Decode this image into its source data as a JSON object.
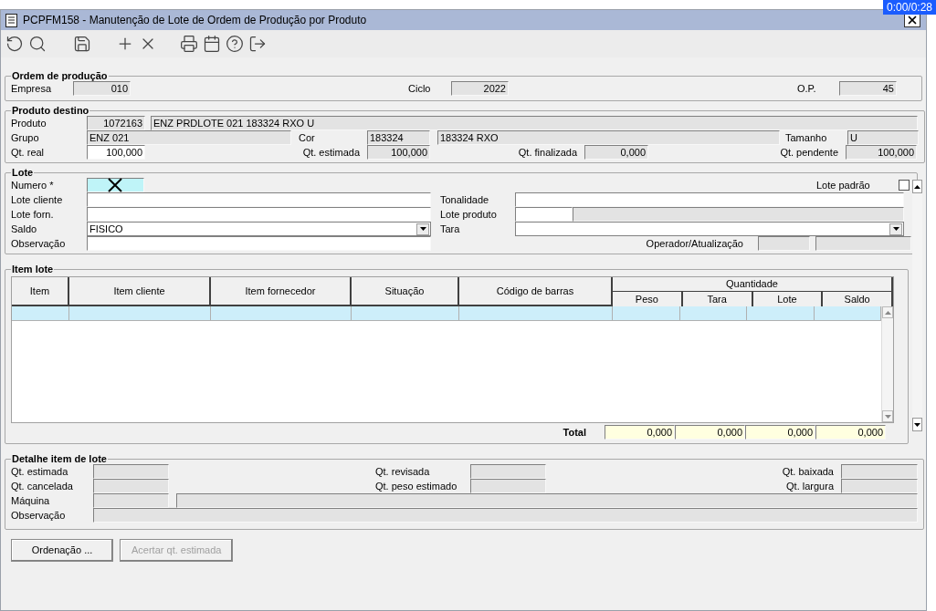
{
  "window": {
    "title": "PCPFM158 - Manutenção de Lote de Ordem de Produção por Produto"
  },
  "player_time": "0:00/0:28",
  "ordem": {
    "title": "Ordem de produção",
    "fields": [
      {
        "label": "Empresa",
        "value": "010"
      },
      {
        "label": "Ciclo",
        "value": "2022"
      },
      {
        "label": "O.P.",
        "value": "45"
      }
    ]
  },
  "produto": {
    "title": "Produto destino",
    "produto": {
      "label": "Produto",
      "code": "1072163",
      "name": "ENZ PRDLOTE 021 183324 RXO U"
    },
    "grupo": {
      "label": "Grupo",
      "value": "ENZ 021"
    },
    "cor": {
      "label": "Cor",
      "code": "183324",
      "name": "183324 RXO"
    },
    "tamanho": {
      "label": "Tamanho",
      "value": "U"
    },
    "qt_real": {
      "label": "Qt. real",
      "value": "100,000"
    },
    "qt_estimada": {
      "label": "Qt. estimada",
      "value": "100,000"
    },
    "qt_finalizada": {
      "label": "Qt. finalizada",
      "value": "0,000"
    },
    "qt_pendente": {
      "label": "Qt. pendente",
      "value": "100,000"
    }
  },
  "lote": {
    "title": "Lote",
    "numero": {
      "label": "Numero *",
      "focused": true
    },
    "lote_padrao": {
      "label": "Lote padrão",
      "checked": false
    },
    "lote_cliente": {
      "label": "Lote cliente"
    },
    "tonalidade": {
      "label": "Tonalidade"
    },
    "lote_forn": {
      "label": "Lote forn."
    },
    "lote_produto": {
      "label": "Lote produto"
    },
    "saldo": {
      "label": "Saldo",
      "value": "FISICO"
    },
    "tara": {
      "label": "Tara"
    },
    "observacao": {
      "label": "Observação"
    },
    "operador": {
      "label": "Operador/Atualização"
    }
  },
  "item_lote": {
    "title": "Item lote",
    "columns": [
      "Item",
      "Item cliente",
      "Item fornecedor",
      "Situação",
      "Código de barras"
    ],
    "group": {
      "label": "Quantidade",
      "columns": [
        "Peso",
        "Tara",
        "Lote",
        "Saldo"
      ]
    },
    "rows": [
      {
        "selected": true
      }
    ],
    "total": {
      "label": "Total",
      "values": [
        "0,000",
        "0,000",
        "0,000",
        "0,000"
      ]
    }
  },
  "detalhe": {
    "title": "Detalhe item de lote",
    "labels": [
      "Qt. estimada",
      "Qt. revisada",
      "Qt. baixada",
      "Qt. cancelada",
      "Qt. peso estimado",
      "Qt. largura",
      "Máquina",
      "Observação"
    ]
  },
  "buttons": [
    {
      "label": "Ordenação ...",
      "disabled": false
    },
    {
      "label": "Acertar qt. estimada",
      "disabled": true
    }
  ]
}
